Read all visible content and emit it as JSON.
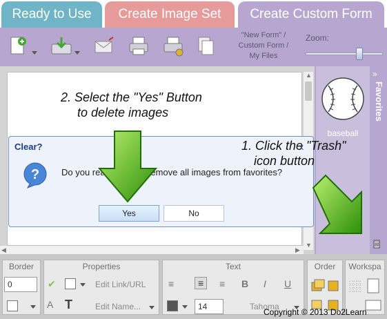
{
  "tabs": [
    {
      "label": "Ready to Use"
    },
    {
      "label": "Create Image Set"
    },
    {
      "label": "Create Custom Form"
    }
  ],
  "toolbar": {
    "breadcrumb": [
      "\"New Form\" /",
      "Custom Form /",
      "My Files"
    ],
    "zoom_label": "Zoom:",
    "zoom_level": 0.7
  },
  "favorites": {
    "title": "Favorites",
    "collapse_glyph": "»",
    "item_label": "baseball"
  },
  "dialog": {
    "title": "Clear?",
    "close": "x",
    "message": "Do you really want to remove all images from favorites?",
    "yes_label": "Yes",
    "no_label": "No"
  },
  "annotations": {
    "step2_line1": "2. Select the \"Yes\" Button",
    "step2_line2": "to delete images",
    "step1_line1": "1. Click the \"Trash\"",
    "step1_line2": "icon button"
  },
  "bottom": {
    "border": {
      "title": "Border",
      "value": "0"
    },
    "properties": {
      "title": "Properties",
      "edit_link": "Edit Link/URL",
      "edit_name": "Edit Name..."
    },
    "text": {
      "title": "Text",
      "font_size": "14",
      "font_name": "Tahoma"
    },
    "order": {
      "title": "Order"
    },
    "workspace": {
      "title": "Workspa"
    }
  },
  "copyright": "Copyright © 2013 Do2Learn",
  "colors": {
    "tab_ready": "#6fb5c7",
    "tab_image": "#e79a9a",
    "tab_custom": "#b7a7d0",
    "arrow_green": "#3fae0f"
  }
}
